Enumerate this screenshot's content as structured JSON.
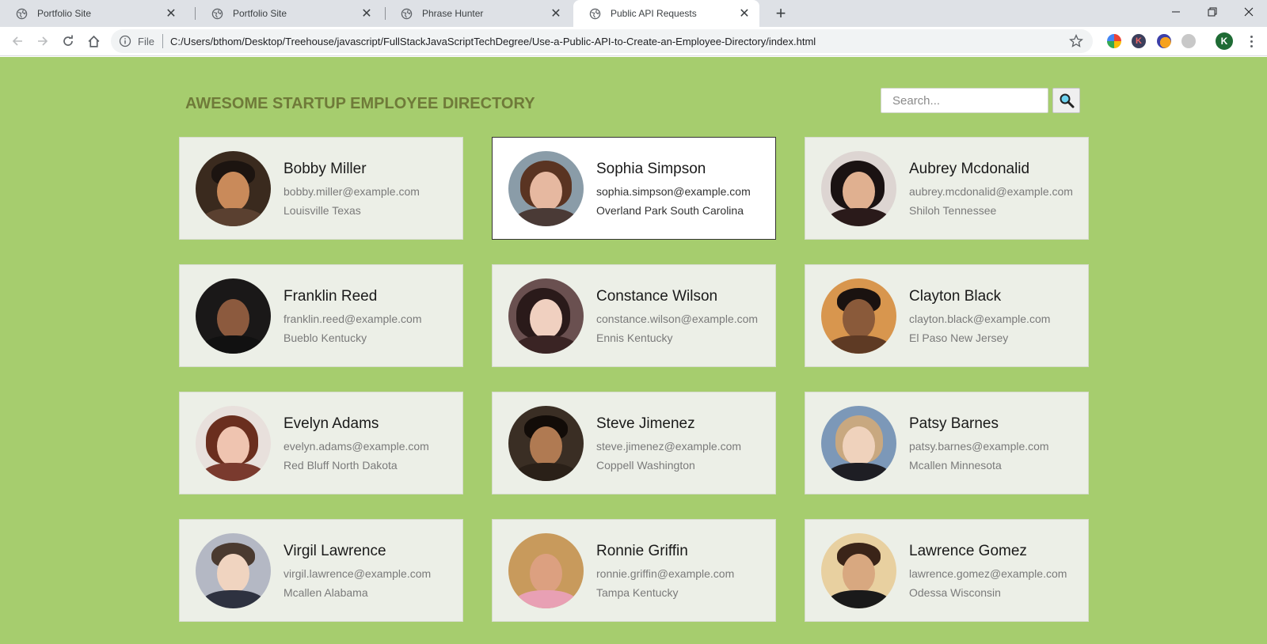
{
  "browser": {
    "tabs": [
      {
        "title": "Portfolio Site",
        "active": false
      },
      {
        "title": "Portfolio Site",
        "active": false
      },
      {
        "title": "Phrase Hunter",
        "active": false
      },
      {
        "title": "Public API Requests",
        "active": true
      }
    ],
    "address": {
      "scheme_label": "File",
      "url": "C:/Users/bthom/Desktop/Treehouse/javascript/FullStackJavaScriptTechDegree/Use-a-Public-API-to-Create-an-Employee-Directory/index.html"
    },
    "profile_initial": "K",
    "extensions": [
      "color-wheel-extension-icon",
      "k-extension-icon",
      "orange-extension-icon",
      "gray-extension-icon"
    ]
  },
  "page": {
    "title": "AWESOME STARTUP EMPLOYEE DIRECTORY",
    "search": {
      "placeholder": "Search...",
      "value": ""
    },
    "colors": {
      "background": "#a6cd6e",
      "title": "#6f7a39",
      "card": "#ecefe7"
    },
    "employees": [
      {
        "name": "Bobby Miller",
        "email": "bobby.miller@example.com",
        "location": "Louisville Texas"
      },
      {
        "name": "Sophia Simpson",
        "email": "sophia.simpson@example.com",
        "location": "Overland Park South Carolina",
        "highlighted": true
      },
      {
        "name": "Aubrey Mcdonalid",
        "email": "aubrey.mcdonalid@example.com",
        "location": "Shiloh Tennessee"
      },
      {
        "name": "Franklin Reed",
        "email": "franklin.reed@example.com",
        "location": "Bueblo Kentucky"
      },
      {
        "name": "Constance Wilson",
        "email": "constance.wilson@example.com",
        "location": "Ennis Kentucky"
      },
      {
        "name": "Clayton Black",
        "email": "clayton.black@example.com",
        "location": "El Paso New Jersey"
      },
      {
        "name": "Evelyn Adams",
        "email": "evelyn.adams@example.com",
        "location": "Red Bluff North Dakota"
      },
      {
        "name": "Steve Jimenez",
        "email": "steve.jimenez@example.com",
        "location": "Coppell Washington"
      },
      {
        "name": "Patsy Barnes",
        "email": "patsy.barnes@example.com",
        "location": "Mcallen Minnesota"
      },
      {
        "name": "Virgil Lawrence",
        "email": "virgil.lawrence@example.com",
        "location": "Mcallen Alabama"
      },
      {
        "name": "Ronnie Griffin",
        "email": "ronnie.griffin@example.com",
        "location": "Tampa Kentucky"
      },
      {
        "name": "Lawrence Gomez",
        "email": "lawrence.gomez@example.com",
        "location": "Odessa Wisconsin"
      }
    ]
  }
}
